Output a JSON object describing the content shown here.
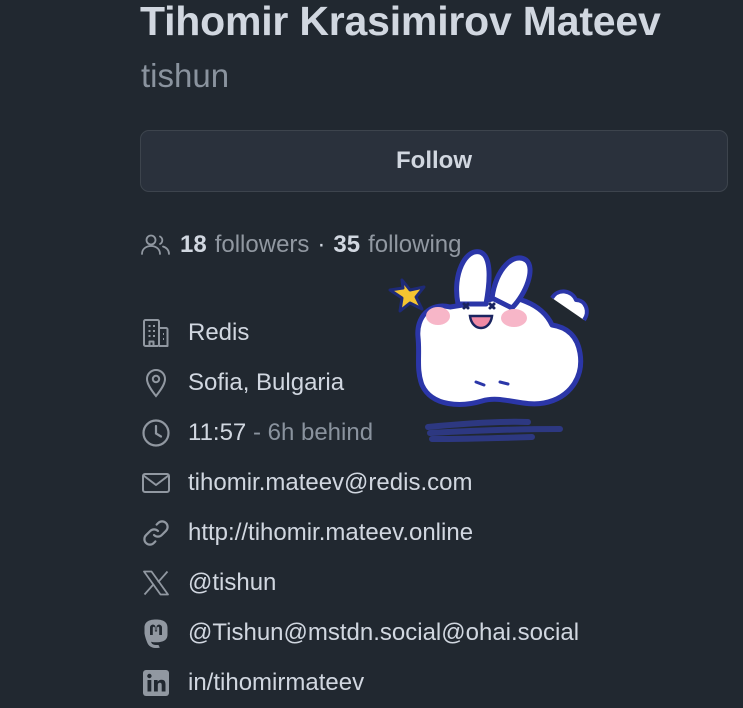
{
  "profile": {
    "full_name": "Tihomir Krasimirov Mateev",
    "login": "tishun",
    "follow_label": "Follow"
  },
  "social": {
    "followers_count": "18",
    "followers_label": "followers",
    "separator": "·",
    "following_count": "35",
    "following_label": "following",
    "icon": "people-icon"
  },
  "details": [
    {
      "name": "organization",
      "icon": "organization-icon",
      "text": "Redis"
    },
    {
      "name": "location",
      "icon": "location-icon",
      "text": "Sofia, Bulgaria"
    },
    {
      "name": "local-time",
      "icon": "clock-icon",
      "text": "11:57",
      "extra": " - 6h behind"
    },
    {
      "name": "email",
      "icon": "mail-icon",
      "text": "tihomir.mateev@redis.com"
    },
    {
      "name": "website",
      "icon": "link-icon",
      "text": "http://tihomir.mateev.online"
    },
    {
      "name": "x-account",
      "icon": "x-logo-icon",
      "text": "@tishun"
    },
    {
      "name": "mastodon-account",
      "icon": "mastodon-icon",
      "text": "@Tishun@mstdn.social@ohai.social"
    },
    {
      "name": "linkedin-account",
      "icon": "linkedin-icon",
      "text": "in/tihomirmateev"
    }
  ],
  "colors": {
    "background": "#212830",
    "text": "#d1d7e0",
    "muted": "#8a939e",
    "button_bg": "#2a313c",
    "button_border": "#3d444d"
  }
}
